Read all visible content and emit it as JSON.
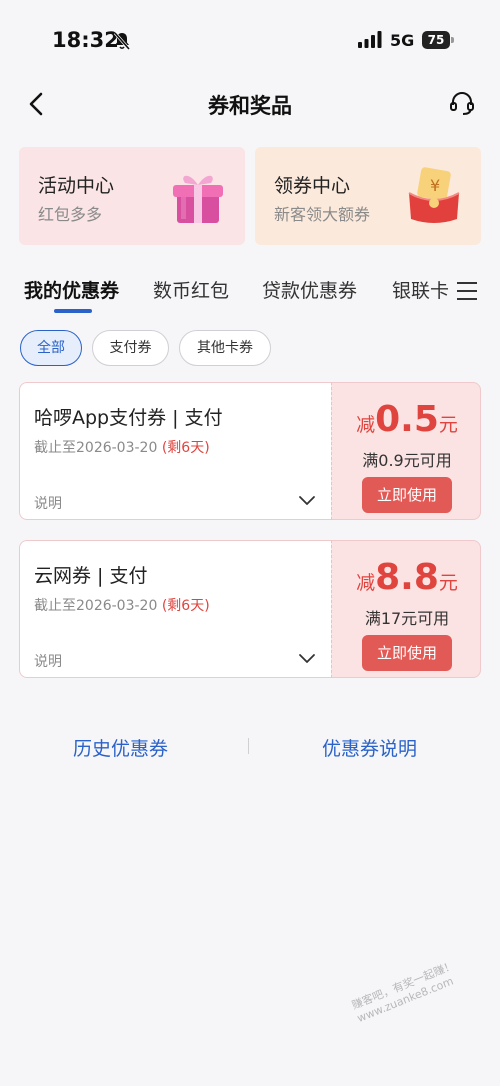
{
  "status_bar": {
    "time": "18:32",
    "network": "5G",
    "battery": "75"
  },
  "nav": {
    "title": "券和奖品"
  },
  "promos": [
    {
      "title": "活动中心",
      "subtitle": "红包多多",
      "icon": "gift-box-icon"
    },
    {
      "title": "领券中心",
      "subtitle": "新客领大额券",
      "icon": "red-envelope-icon"
    }
  ],
  "tabs": [
    {
      "label": "我的优惠券",
      "active": true
    },
    {
      "label": "数币红包",
      "active": false
    },
    {
      "label": "贷款优惠券",
      "active": false
    },
    {
      "label": "银联卡",
      "active": false
    }
  ],
  "filters": [
    {
      "label": "全部",
      "active": true
    },
    {
      "label": "支付券",
      "active": false
    },
    {
      "label": "其他卡券",
      "active": false
    }
  ],
  "coupons": [
    {
      "title": "哈啰App支付券 | 支付",
      "expiry": "截止至2026-03-20",
      "remaining": "(剩6天)",
      "desc_label": "说明",
      "prefix": "减",
      "amount": "0.5",
      "unit": "元",
      "condition": "满0.9元可用",
      "button": "立即使用"
    },
    {
      "title": "云网券 | 支付",
      "expiry": "截止至2026-03-20",
      "remaining": "(剩6天)",
      "desc_label": "说明",
      "prefix": "减",
      "amount": "8.8",
      "unit": "元",
      "condition": "满17元可用",
      "button": "立即使用"
    }
  ],
  "bottom_links": {
    "history": "历史优惠券",
    "explanation": "优惠券说明"
  },
  "watermark": {
    "line1": "赚客吧，有奖一起赚！",
    "line2": "www.zuanke8.com"
  },
  "colors": {
    "accent_blue": "#2b62c9",
    "coupon_red": "#e0443e",
    "button_red": "#e25a56"
  }
}
